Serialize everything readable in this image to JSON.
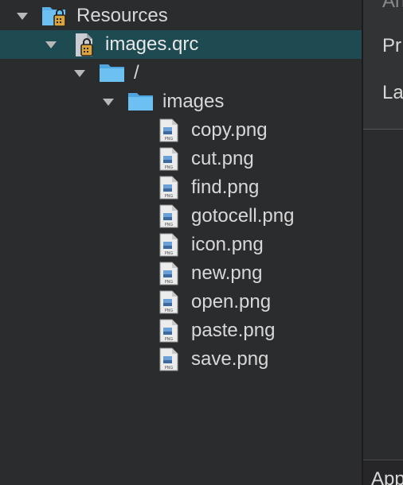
{
  "tree": {
    "resources_label": "Resources",
    "qrc_label": "images.qrc",
    "prefix_label": "/",
    "folder_label": "images",
    "files": [
      "copy.png",
      "cut.png",
      "find.png",
      "gotocell.png",
      "icon.png",
      "new.png",
      "open.png",
      "paste.png",
      "save.png"
    ]
  },
  "right_panel": {
    "item0": "An",
    "item1": "Pr",
    "item2": "La",
    "bottom": "App"
  },
  "colors": {
    "background": "#2b2c2e",
    "selection": "#1e4a52",
    "folder": "#5ab0e8",
    "text": "#d8d8d8"
  }
}
